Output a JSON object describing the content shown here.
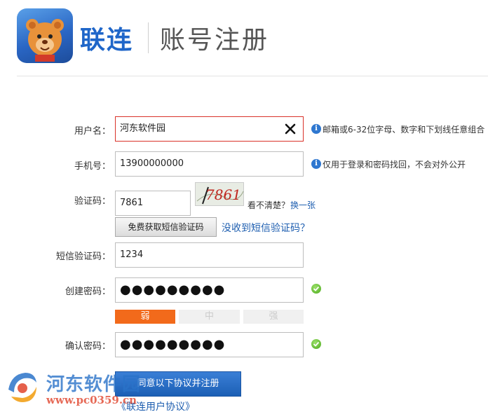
{
  "header": {
    "brand": "联连",
    "title": "账号注册"
  },
  "form": {
    "username": {
      "label": "用户名：",
      "value": "河东软件园",
      "hint": "邮箱或6-32位字母、数字和下划线任意组合"
    },
    "phone": {
      "label": "手机号：",
      "value": "13900000000",
      "hint": "仅用于登录和密码找回，不会对外公开"
    },
    "captcha": {
      "label": "验证码：",
      "value": "7861",
      "image_text": "7861",
      "unclear_text": "看不清楚？",
      "refresh_link": "换一张",
      "sms_button": "免费获取短信验证码",
      "no_sms_link": "没收到短信验证码？"
    },
    "sms_code": {
      "label": "短信验证码：",
      "value": "1234"
    },
    "password": {
      "label": "创建密码：",
      "masked_value": "●●●●●●●●●"
    },
    "strength": {
      "weak": "弱",
      "medium": "中",
      "strong": "强",
      "level": "weak"
    },
    "confirm_password": {
      "label": "确认密码：",
      "masked_value": "●●●●●●●●●"
    },
    "submit_button": "同意以下协议并注册",
    "agreement_link": "《联连用户协议》"
  },
  "watermark": {
    "name": "河东软件园",
    "url": "www.pc0359.cn"
  },
  "colors": {
    "brand_blue": "#1f66c9",
    "error_border": "#d9322a",
    "weak": "#f26a1b",
    "button_blue": "#2a6fc6"
  }
}
